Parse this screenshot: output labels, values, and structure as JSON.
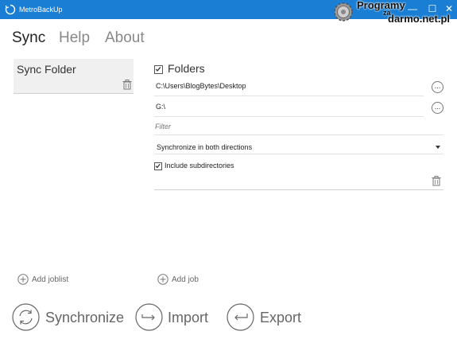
{
  "window": {
    "title": "MetroBackUp",
    "minimize_glyph": "—",
    "maximize_glyph": "☐",
    "close_glyph": "✕"
  },
  "watermark": {
    "line1": "Programy",
    "line2": "za",
    "line3": "darmo.net.pl"
  },
  "nav": {
    "tabs": [
      {
        "label": "Sync",
        "active": true
      },
      {
        "label": "Help",
        "active": false
      },
      {
        "label": "About",
        "active": false
      }
    ]
  },
  "joblist": {
    "items": [
      {
        "label": "Sync Folder"
      }
    ]
  },
  "job": {
    "folders_label": "Folders",
    "folders_checked": true,
    "source_path": "C:\\Users\\BlogBytes\\Desktop",
    "target_path": "G:\\",
    "browse_label": "...",
    "filter_placeholder": "Filter",
    "direction": "Synchronize in both directions",
    "include_subdirs_label": "Include subdirectories",
    "include_subdirs_checked": true
  },
  "actions": {
    "add_joblist": "Add joblist",
    "add_job": "Add job",
    "synchronize": "Synchronize",
    "import": "Import",
    "export": "Export"
  },
  "colors": {
    "titlebar": "#1a7fd4",
    "nav_active": "#222222",
    "nav_inactive": "#888888",
    "list_item_bg": "#f0f0f0"
  },
  "icons": {
    "app": "sync-circle-icon",
    "trash": "trash-icon",
    "plus": "plus-circle-icon",
    "synchronize": "sync-arrows-icon",
    "import": "import-arrow-icon",
    "export": "export-arrow-icon"
  }
}
